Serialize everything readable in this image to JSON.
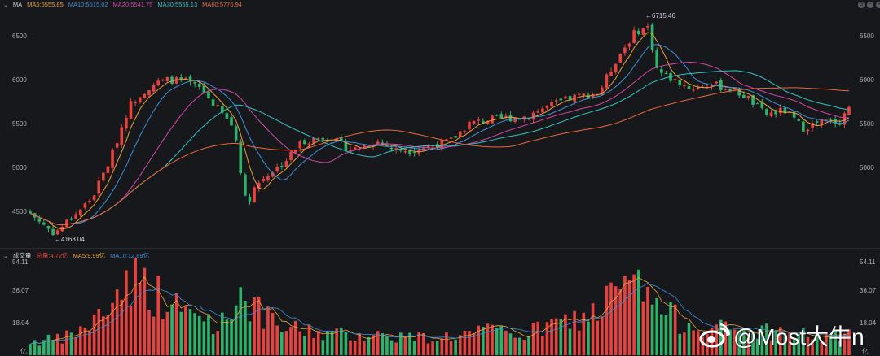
{
  "header": {
    "label": "MA",
    "ma": [
      {
        "text": "MA5:5555.85",
        "color": "#e8a33c"
      },
      {
        "text": "MA10:5515.02",
        "color": "#3f8fd8"
      },
      {
        "text": "MA20:5541.75",
        "color": "#d545a8"
      },
      {
        "text": "MA30:5555.13",
        "color": "#36c2c2"
      },
      {
        "text": "MA60:5776.94",
        "color": "#e8683a"
      }
    ]
  },
  "volume_header": {
    "label": "成交量",
    "total": "总量:4.72亿",
    "ma5": "MA5:9.99亿",
    "ma10": "MA10:12.89亿"
  },
  "colors": {
    "up": "#e8423f",
    "down": "#2fb36a",
    "ma5": "#e8a33c",
    "ma10": "#3f8fd8",
    "ma20": "#d545a8",
    "ma30": "#36c2c2",
    "ma60": "#e8683a"
  },
  "watermark": "@Most大牛n",
  "chart_data": {
    "type": "candlestick",
    "price_axis": {
      "ticks": [
        "6500",
        "6000",
        "5500",
        "5000",
        "4500"
      ],
      "range": [
        4100,
        6800
      ]
    },
    "volume_axis": {
      "ticks": [
        "54.11",
        "36.07",
        "18.04"
      ],
      "unit": "亿",
      "range": [
        0,
        54.11
      ]
    },
    "annotations": {
      "high": "6715.46",
      "low": "4168.04"
    },
    "candle_count": 180,
    "close_waypoints": [
      [
        0,
        4480
      ],
      [
        6,
        4300
      ],
      [
        8,
        4250
      ],
      [
        14,
        4450
      ],
      [
        20,
        4650
      ],
      [
        26,
        5100
      ],
      [
        32,
        5700
      ],
      [
        36,
        5850
      ],
      [
        40,
        5950
      ],
      [
        45,
        6000
      ],
      [
        50,
        5980
      ],
      [
        55,
        5900
      ],
      [
        60,
        5700
      ],
      [
        66,
        5450
      ],
      [
        70,
        4550
      ],
      [
        72,
        4750
      ],
      [
        76,
        4900
      ],
      [
        82,
        5050
      ],
      [
        88,
        5300
      ],
      [
        96,
        5350
      ],
      [
        104,
        5200
      ],
      [
        112,
        5300
      ],
      [
        118,
        5200
      ],
      [
        124,
        5200
      ],
      [
        130,
        5250
      ],
      [
        136,
        5300
      ],
      [
        142,
        5500
      ],
      [
        150,
        5550
      ],
      [
        160,
        5580
      ],
      [
        168,
        5700
      ],
      [
        176,
        5800
      ],
      [
        184,
        5850
      ],
      [
        190,
        6250
      ],
      [
        196,
        6550
      ],
      [
        200,
        6600
      ],
      [
        203,
        6100
      ],
      [
        208,
        6000
      ],
      [
        214,
        5900
      ],
      [
        220,
        5950
      ],
      [
        226,
        5900
      ],
      [
        232,
        5800
      ],
      [
        238,
        5600
      ],
      [
        244,
        5650
      ],
      [
        250,
        5450
      ],
      [
        256,
        5520
      ],
      [
        262,
        5520
      ],
      [
        265,
        5700
      ]
    ],
    "volume_waypoints": [
      [
        0,
        8
      ],
      [
        10,
        9
      ],
      [
        20,
        18
      ],
      [
        26,
        30
      ],
      [
        32,
        46
      ],
      [
        38,
        40
      ],
      [
        44,
        30
      ],
      [
        50,
        25
      ],
      [
        56,
        22
      ],
      [
        62,
        18
      ],
      [
        68,
        38
      ],
      [
        74,
        25
      ],
      [
        80,
        16
      ],
      [
        90,
        14
      ],
      [
        100,
        12
      ],
      [
        110,
        12
      ],
      [
        120,
        11
      ],
      [
        130,
        10
      ],
      [
        140,
        12
      ],
      [
        150,
        14
      ],
      [
        160,
        12
      ],
      [
        170,
        18
      ],
      [
        180,
        22
      ],
      [
        186,
        30
      ],
      [
        192,
        40
      ],
      [
        198,
        38
      ],
      [
        204,
        26
      ],
      [
        210,
        20
      ],
      [
        220,
        16
      ],
      [
        230,
        14
      ],
      [
        240,
        14
      ],
      [
        250,
        12
      ],
      [
        260,
        10
      ],
      [
        265,
        14
      ]
    ]
  }
}
